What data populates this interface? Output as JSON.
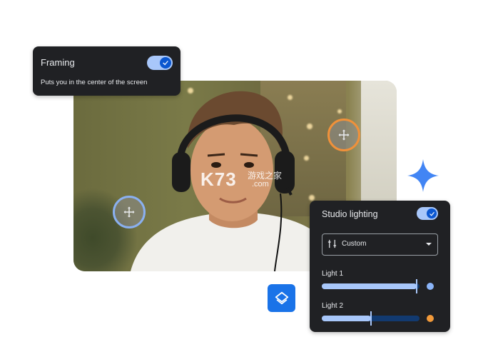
{
  "framing": {
    "title": "Framing",
    "description": "Puts you in the center of the screen",
    "enabled": true
  },
  "studio_lighting": {
    "title": "Studio lighting",
    "enabled": true,
    "mode": "Custom",
    "lights": [
      {
        "label": "Light 1",
        "level": 0.97,
        "color": "#8ab4f8"
      },
      {
        "label": "Light 2",
        "level": 0.5,
        "color": "#f29a3a"
      }
    ]
  },
  "watermark": {
    "brand": "K73",
    "site": "游戏之家",
    "domain": ".com"
  },
  "colors": {
    "card_bg": "#202124",
    "accent_blue": "#a8c7fa",
    "toggle_knob": "#0b57d0",
    "light1_handle": "#8ab0f0",
    "light2_handle": "#f0913a",
    "sparkle": "#4285f4"
  },
  "icons": [
    "move-icon",
    "check-icon",
    "tune-icon",
    "sparkle-icon",
    "layers-icon"
  ]
}
